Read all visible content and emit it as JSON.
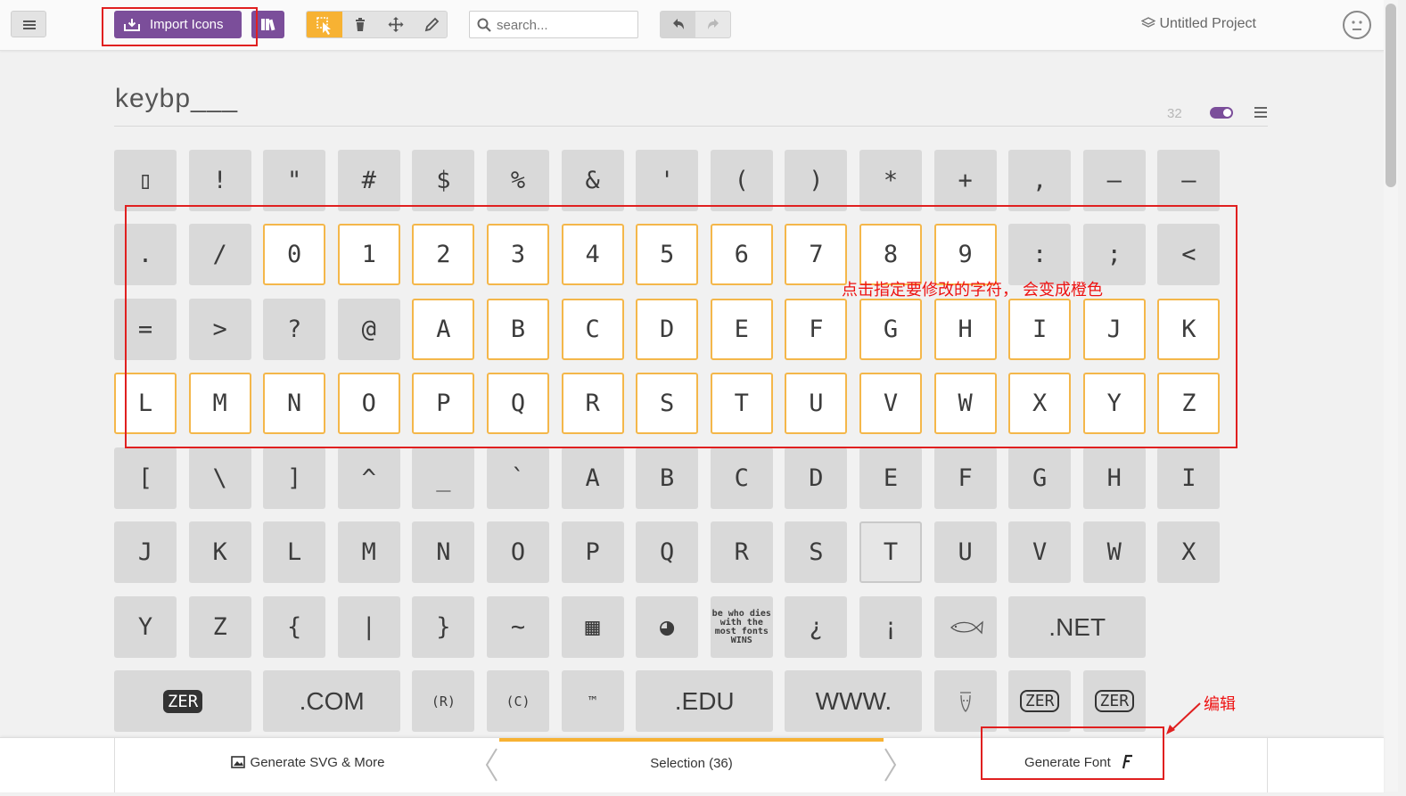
{
  "header": {
    "import_label": "Import Icons",
    "search_placeholder": "search...",
    "project_name": "Untitled Project"
  },
  "set": {
    "title": "keybp___",
    "size": "32"
  },
  "glyph_rows": [
    [
      "▯",
      "!",
      "\"",
      "#",
      "$",
      "%",
      "&",
      "'",
      "(",
      ")",
      "*",
      "+",
      ",",
      "–",
      "–"
    ],
    [
      ".",
      "/",
      "0",
      "1",
      "2",
      "3",
      "4",
      "5",
      "6",
      "7",
      "8",
      "9",
      ":",
      ";",
      "<"
    ],
    [
      "=",
      ">",
      "?",
      "@",
      "A",
      "B",
      "C",
      "D",
      "E",
      "F",
      "G",
      "H",
      "I",
      "J",
      "K"
    ],
    [
      "L",
      "M",
      "N",
      "O",
      "P",
      "Q",
      "R",
      "S",
      "T",
      "U",
      "V",
      "W",
      "X",
      "Y",
      "Z"
    ],
    [
      "[",
      "\\",
      "]",
      "^",
      "_",
      "`",
      "A",
      "B",
      "C",
      "D",
      "E",
      "F",
      "G",
      "H",
      "I"
    ],
    [
      "J",
      "K",
      "L",
      "M",
      "N",
      "O",
      "P",
      "Q",
      "R",
      "S",
      "T",
      "U",
      "V",
      "W",
      "X"
    ],
    [
      "Y",
      "Z",
      "{",
      "|",
      "}",
      "~",
      "▦",
      "◕",
      "be who dies with the most fonts WINS",
      "¿",
      "¡",
      "fish-glyph",
      ".NET"
    ],
    [
      "ZER",
      ".COM",
      "(R)",
      "(C)",
      "™",
      ".EDU",
      "WWW.",
      "skull-glyph",
      "ZER",
      "ZER"
    ]
  ],
  "annotations": {
    "select_note": "点击指定要修改的字符， 会变成橙色",
    "edit_note": "编辑"
  },
  "footer": {
    "generate_svg_label": "Generate SVG & More",
    "selection_label": "Selection (36)",
    "generate_font_label": "Generate Font"
  },
  "colors": {
    "accent_purple": "#7b4e9a",
    "accent_orange": "#f7b233",
    "selected_border": "#f4b74a",
    "annotation_red": "#e02020"
  }
}
